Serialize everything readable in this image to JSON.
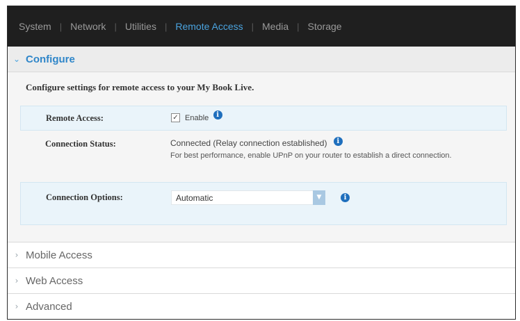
{
  "nav": {
    "items": [
      {
        "label": "System"
      },
      {
        "label": "Network"
      },
      {
        "label": "Utilities"
      },
      {
        "label": "Remote Access"
      },
      {
        "label": "Media"
      },
      {
        "label": "Storage"
      }
    ],
    "active": "Remote Access"
  },
  "configure": {
    "title": "Configure",
    "description": "Configure settings for remote access to your My Book Live.",
    "remote_access": {
      "label": "Remote Access:",
      "checkbox_label": "Enable",
      "checked": true
    },
    "connection_status": {
      "label": "Connection Status:",
      "value": "Connected (Relay connection established)",
      "note": "For best performance, enable UPnP on your router to establish a direct connection."
    },
    "connection_options": {
      "label": "Connection Options:",
      "selected": "Automatic"
    }
  },
  "sections": {
    "mobile_access": "Mobile Access",
    "web_access": "Web Access",
    "advanced": "Advanced"
  },
  "icons": {
    "info": "info-icon",
    "chevron_open": "chevron-down-icon",
    "chevron_closed": "chevron-right-icon"
  },
  "colors": {
    "nav_bg": "#1f1f1f",
    "accent": "#2f86c9",
    "highlight_row": "#eaf4fa"
  }
}
